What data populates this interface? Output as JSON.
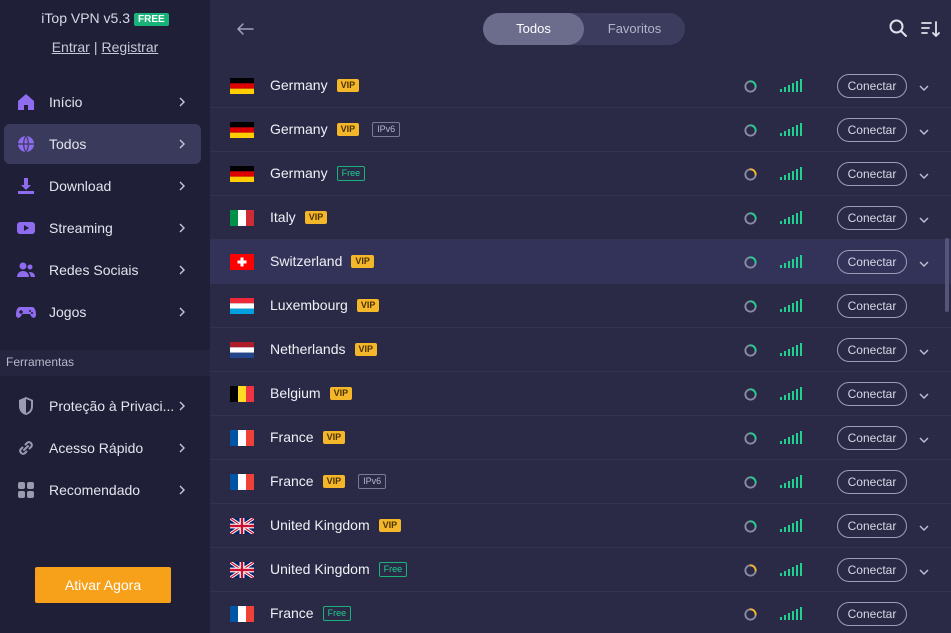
{
  "app": {
    "title": "iTop VPN v5.3",
    "badge": "FREE"
  },
  "auth": {
    "login": "Entrar",
    "separator": "|",
    "register": "Registrar"
  },
  "nav": [
    {
      "label": "Início",
      "icon": "home-icon",
      "color": "#8f6bf0"
    },
    {
      "label": "Todos",
      "icon": "globe-icon",
      "color": "#8f6bf0",
      "active": true
    },
    {
      "label": "Download",
      "icon": "download-icon",
      "color": "#8f6bf0"
    },
    {
      "label": "Streaming",
      "icon": "play-icon",
      "color": "#8f6bf0"
    },
    {
      "label": "Redes Sociais",
      "icon": "people-icon",
      "color": "#8f6bf0"
    },
    {
      "label": "Jogos",
      "icon": "gamepad-icon",
      "color": "#8f6bf0"
    }
  ],
  "tools_section": "Ferramentas",
  "tools": [
    {
      "label": "Proteção à Privaci...",
      "icon": "shield-icon"
    },
    {
      "label": "Acesso Rápido",
      "icon": "link-icon"
    },
    {
      "label": "Recomendado",
      "icon": "grid-icon"
    }
  ],
  "activate_button": "Ativar Agora",
  "tabs": [
    {
      "label": "Todos",
      "active": true
    },
    {
      "label": "Favoritos"
    }
  ],
  "servers": [
    {
      "country": "Germany",
      "flag": "de",
      "tags": [
        "VIP"
      ],
      "load": "green",
      "expand": true
    },
    {
      "country": "Germany",
      "flag": "de",
      "tags": [
        "VIP",
        "IPv6"
      ],
      "load": "green",
      "expand": true
    },
    {
      "country": "Germany",
      "flag": "de",
      "tags": [
        "Free"
      ],
      "load": "yellow",
      "expand": true
    },
    {
      "country": "Italy",
      "flag": "it",
      "tags": [
        "VIP"
      ],
      "load": "green",
      "expand": true
    },
    {
      "country": "Switzerland",
      "flag": "ch",
      "tags": [
        "VIP"
      ],
      "load": "green",
      "expand": true,
      "hover": true
    },
    {
      "country": "Luxembourg",
      "flag": "lu",
      "tags": [
        "VIP"
      ],
      "load": "green",
      "expand": false
    },
    {
      "country": "Netherlands",
      "flag": "nl",
      "tags": [
        "VIP"
      ],
      "load": "green",
      "expand": true
    },
    {
      "country": "Belgium",
      "flag": "be",
      "tags": [
        "VIP"
      ],
      "load": "green",
      "expand": true
    },
    {
      "country": "France",
      "flag": "fr",
      "tags": [
        "VIP"
      ],
      "load": "green",
      "expand": true
    },
    {
      "country": "France",
      "flag": "fr",
      "tags": [
        "VIP",
        "IPv6"
      ],
      "load": "green",
      "expand": false
    },
    {
      "country": "United Kingdom",
      "flag": "gb",
      "tags": [
        "VIP"
      ],
      "load": "green",
      "expand": true
    },
    {
      "country": "United Kingdom",
      "flag": "gb",
      "tags": [
        "Free"
      ],
      "load": "yellow",
      "expand": true
    },
    {
      "country": "France",
      "flag": "fr",
      "tags": [
        "Free"
      ],
      "load": "yellow",
      "expand": false
    }
  ],
  "connect_label": "Conectar",
  "colors": {
    "accent": "#f7a11a",
    "signal": "#1fd08e",
    "vip": "#f5b72a",
    "free": "#19b37a",
    "load_yellow": "#f5b72a"
  }
}
